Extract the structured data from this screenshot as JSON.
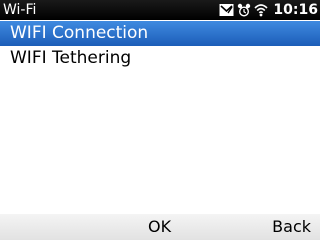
{
  "status_bar": {
    "title": "Wi-Fi",
    "time": "10:16",
    "icons": [
      "message-icon",
      "alarm-icon",
      "wifi-signal-icon"
    ]
  },
  "list": {
    "items": [
      {
        "label": "WIFI Connection",
        "selected": true
      },
      {
        "label": "WIFI Tethering",
        "selected": false
      }
    ]
  },
  "softkeys": {
    "center_label": "OK",
    "right_label": "Back"
  },
  "colors": {
    "selection": "#2a6fd0",
    "status_bar": "#000000",
    "softkey_bar": "#ececec"
  }
}
